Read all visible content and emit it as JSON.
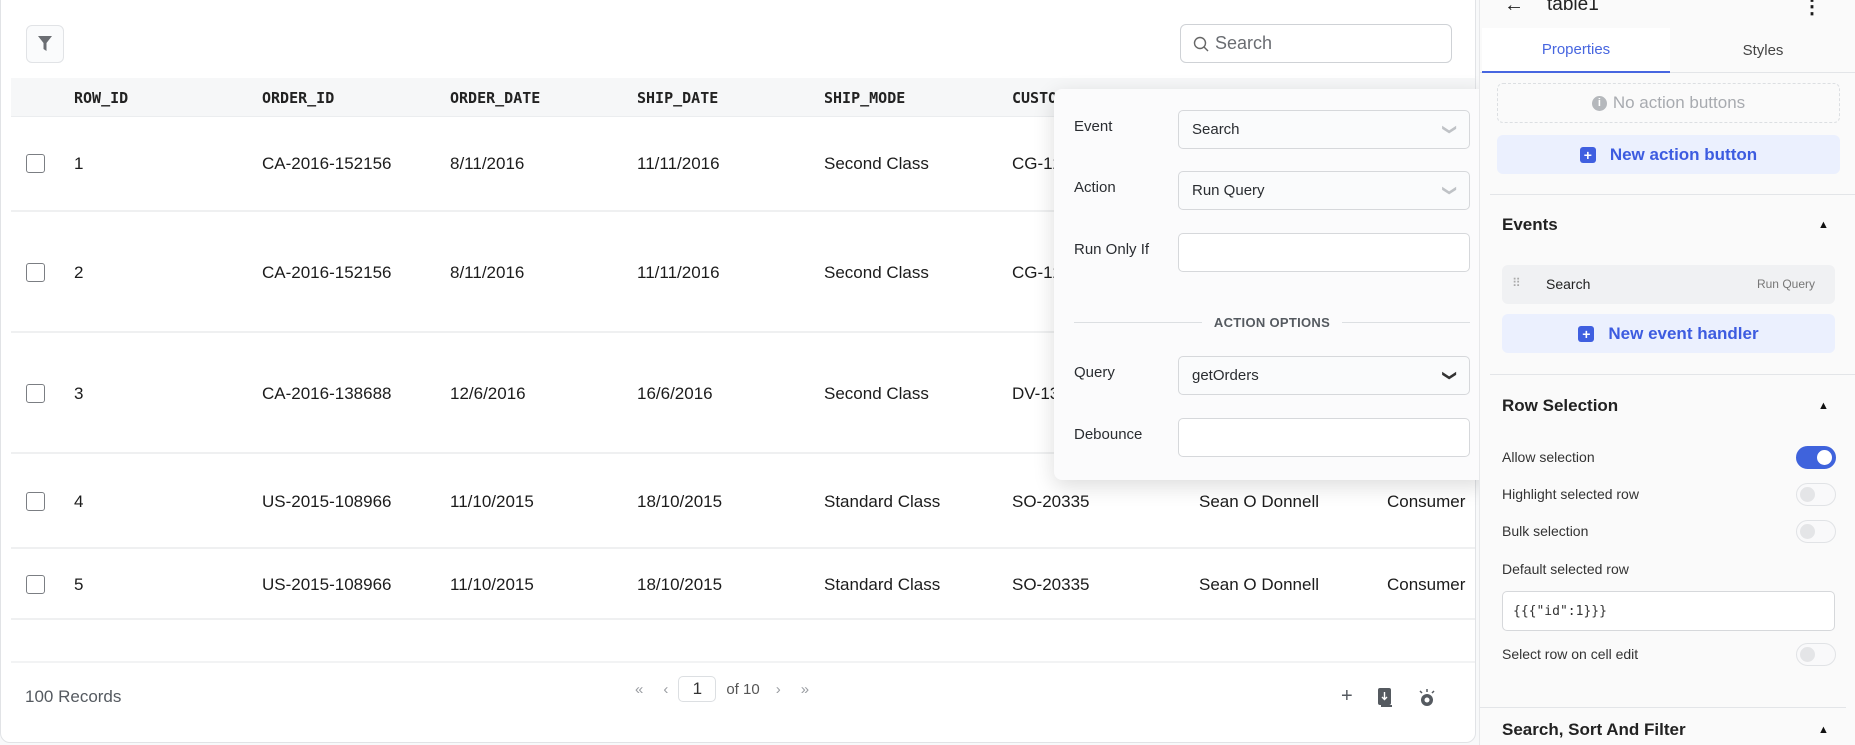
{
  "table": {
    "search_placeholder": "Search",
    "columns": [
      "ROW_ID",
      "ORDER_ID",
      "ORDER_DATE",
      "SHIP_DATE",
      "SHIP_MODE",
      "CUSTOMER_ID"
    ],
    "rows": [
      [
        "1",
        "CA-2016-152156",
        "8/11/2016",
        "11/11/2016",
        "Second Class",
        "CG-12520",
        "",
        ""
      ],
      [
        "2",
        "CA-2016-152156",
        "8/11/2016",
        "11/11/2016",
        "Second Class",
        "CG-12520",
        "",
        ""
      ],
      [
        "3",
        "CA-2016-138688",
        "12/6/2016",
        "16/6/2016",
        "Second Class",
        "DV-13045",
        "",
        ""
      ],
      [
        "4",
        "US-2015-108966",
        "11/10/2015",
        "18/10/2015",
        "Standard Class",
        "SO-20335",
        "Sean O Donnell",
        "Consumer"
      ],
      [
        "5",
        "US-2015-108966",
        "11/10/2015",
        "18/10/2015",
        "Standard Class",
        "SO-20335",
        "Sean O Donnell",
        "Consumer"
      ]
    ],
    "records": "100 Records",
    "page": "1",
    "of_pages": "of 10"
  },
  "popover": {
    "event_label": "Event",
    "event_value": "Search",
    "action_label": "Action",
    "action_value": "Run Query",
    "run_only_if_label": "Run Only If",
    "run_only_if_value": "",
    "section": "ACTION OPTIONS",
    "query_label": "Query",
    "query_value": "getOrders",
    "debounce_label": "Debounce",
    "debounce_value": ""
  },
  "panel": {
    "title": "table1",
    "tabs": [
      "Properties",
      "Styles"
    ],
    "no_action": "No action buttons",
    "new_action": "New action button",
    "events_title": "Events",
    "event_name": "Search",
    "event_action": "Run Query",
    "new_event": "New event handler",
    "row_selection_title": "Row Selection",
    "allow_selection": "Allow selection",
    "highlight_selected": "Highlight selected row",
    "bulk_selection": "Bulk selection",
    "default_selected_label": "Default selected row",
    "default_selected_value": "{{{\"id\":1}}}",
    "select_on_edit": "Select row on cell edit",
    "search_sort_title": "Search, Sort And Filter",
    "toggles": {
      "allow_selection": true,
      "highlight_selected": false,
      "bulk_selection": false,
      "select_on_edit": false
    }
  },
  "colors": {
    "accent": "#3f63dc"
  }
}
